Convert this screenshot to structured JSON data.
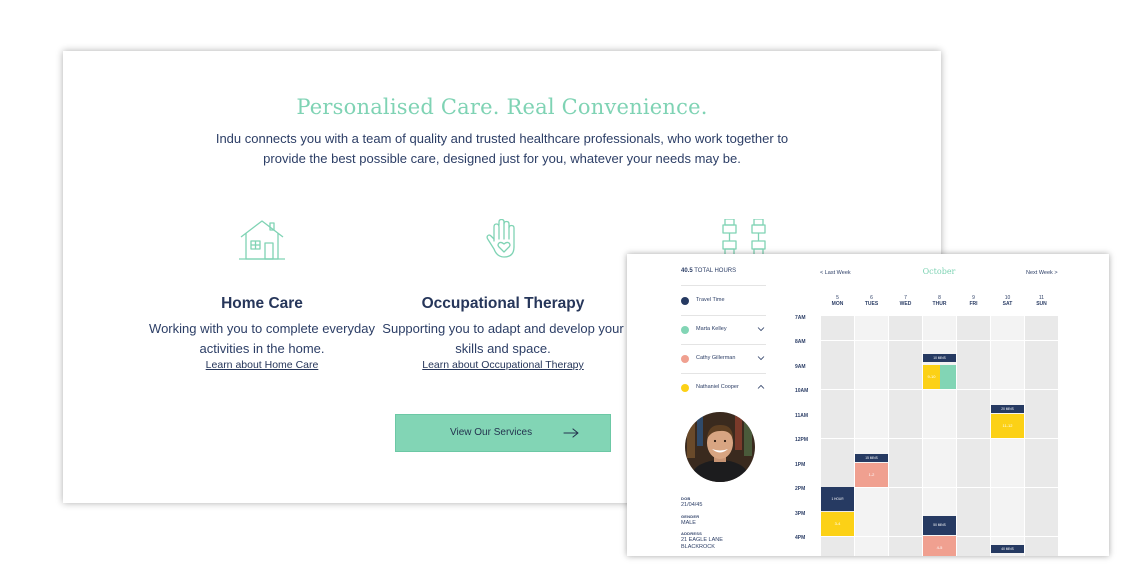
{
  "hero": {
    "title": "Personalised Care. Real Convenience.",
    "subtitle": "Indu connects you with a team of quality and trusted healthcare professionals, who work together to provide the best possible care, designed just for you, whatever your needs may be."
  },
  "services": [
    {
      "icon": "house-icon",
      "title": "Home Care",
      "description": "Working with you to complete everyday activities in the home.",
      "link": "Learn about Home Care"
    },
    {
      "icon": "hand-heart-icon",
      "title": "Occupational Therapy",
      "description": "Supporting you to adapt and develop your skills and space.",
      "link": "Learn about Occupational Therapy"
    },
    {
      "icon": "dumbbell-icon"
    }
  ],
  "cta": {
    "label": "View Our Services"
  },
  "calendar": {
    "total_value": "40.5",
    "total_label": "TOTAL HOURS",
    "nav_prev": "< Last Week",
    "nav_next": "Next Week >",
    "month": "October",
    "legend": [
      {
        "name": "Travel Time",
        "color": "#263a62"
      },
      {
        "name": "Marta Kelley",
        "color": "#82d5b5"
      },
      {
        "name": "Cathy Gillerman",
        "color": "#f0a090"
      },
      {
        "name": "Nathaniel Cooper",
        "color": "#fcd116"
      }
    ],
    "profile": {
      "dob_label": "DOB",
      "dob": "21/04/45",
      "gender_label": "GENDER",
      "gender": "MALE",
      "address_label": "ADDRESS",
      "address_line1": "21 EAGLE LANE",
      "address_line2": "BLACKROCK"
    },
    "days": [
      {
        "num": "5",
        "name": "MON"
      },
      {
        "num": "6",
        "name": "TUES"
      },
      {
        "num": "7",
        "name": "WED"
      },
      {
        "num": "8",
        "name": "THUR"
      },
      {
        "num": "9",
        "name": "FRI"
      },
      {
        "num": "10",
        "name": "SAT"
      },
      {
        "num": "11",
        "name": "SUN"
      }
    ],
    "hours": [
      "7AM",
      "8AM",
      "9AM",
      "10AM",
      "11AM",
      "12PM",
      "1PM",
      "2PM",
      "3PM",
      "4PM"
    ],
    "events": {
      "thu_9": "9-10",
      "sat_11": "11-12",
      "tue_1": "1-2",
      "mon_3": "3-4",
      "thu_4": "4-5",
      "travel_thu_9": "10 MINS",
      "travel_sat_11": "20 MINS",
      "travel_tue_1": "15 MINS",
      "travel_mon_2": "1 HOUR",
      "travel_thu_3": "50 MINS",
      "travel_sat_4": "40 MINS"
    },
    "colors": {
      "travel": "#263a62",
      "marta": "#82d5b5",
      "cathy": "#f0a090",
      "nathaniel": "#fcd116"
    }
  }
}
